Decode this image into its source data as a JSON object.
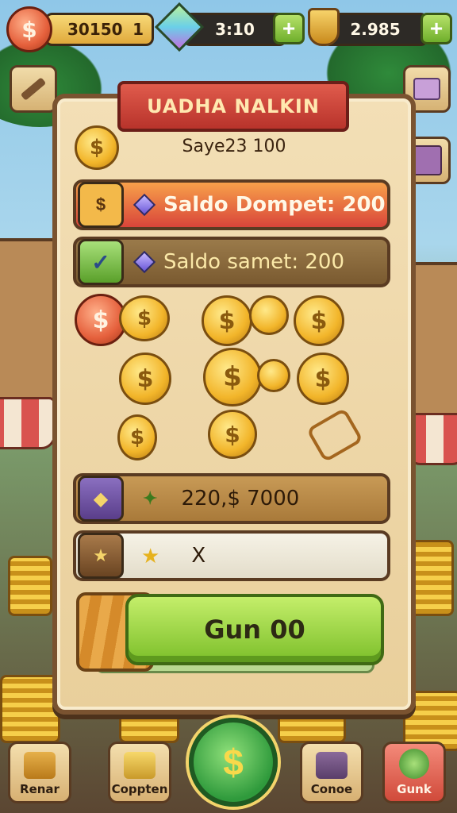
{
  "topbar": {
    "coins_value": "30150",
    "coins_suffix": "1",
    "gems_value": "3:10",
    "shields_value": "2.985"
  },
  "panel": {
    "title": "UADHA NALKIN",
    "header_line": "Saye23 100",
    "wallet_balance": "Saldo Dompet: 200",
    "saved_balance": "Saldo samet: 200",
    "reward_amount": "220,$ 7000",
    "multiplier_text": "X",
    "action_button": "Gun 00"
  },
  "coin_symbol": "$",
  "nav": {
    "items": [
      {
        "label": "Renar"
      },
      {
        "label": "Coppten"
      },
      {
        "label": "Conoe"
      },
      {
        "label": "Gunk"
      }
    ],
    "center_symbol": "$"
  },
  "colors": {
    "accent_red": "#d9453a",
    "accent_green": "#7cbf2a",
    "gold": "#f2b52a",
    "wood": "#7a5330"
  }
}
